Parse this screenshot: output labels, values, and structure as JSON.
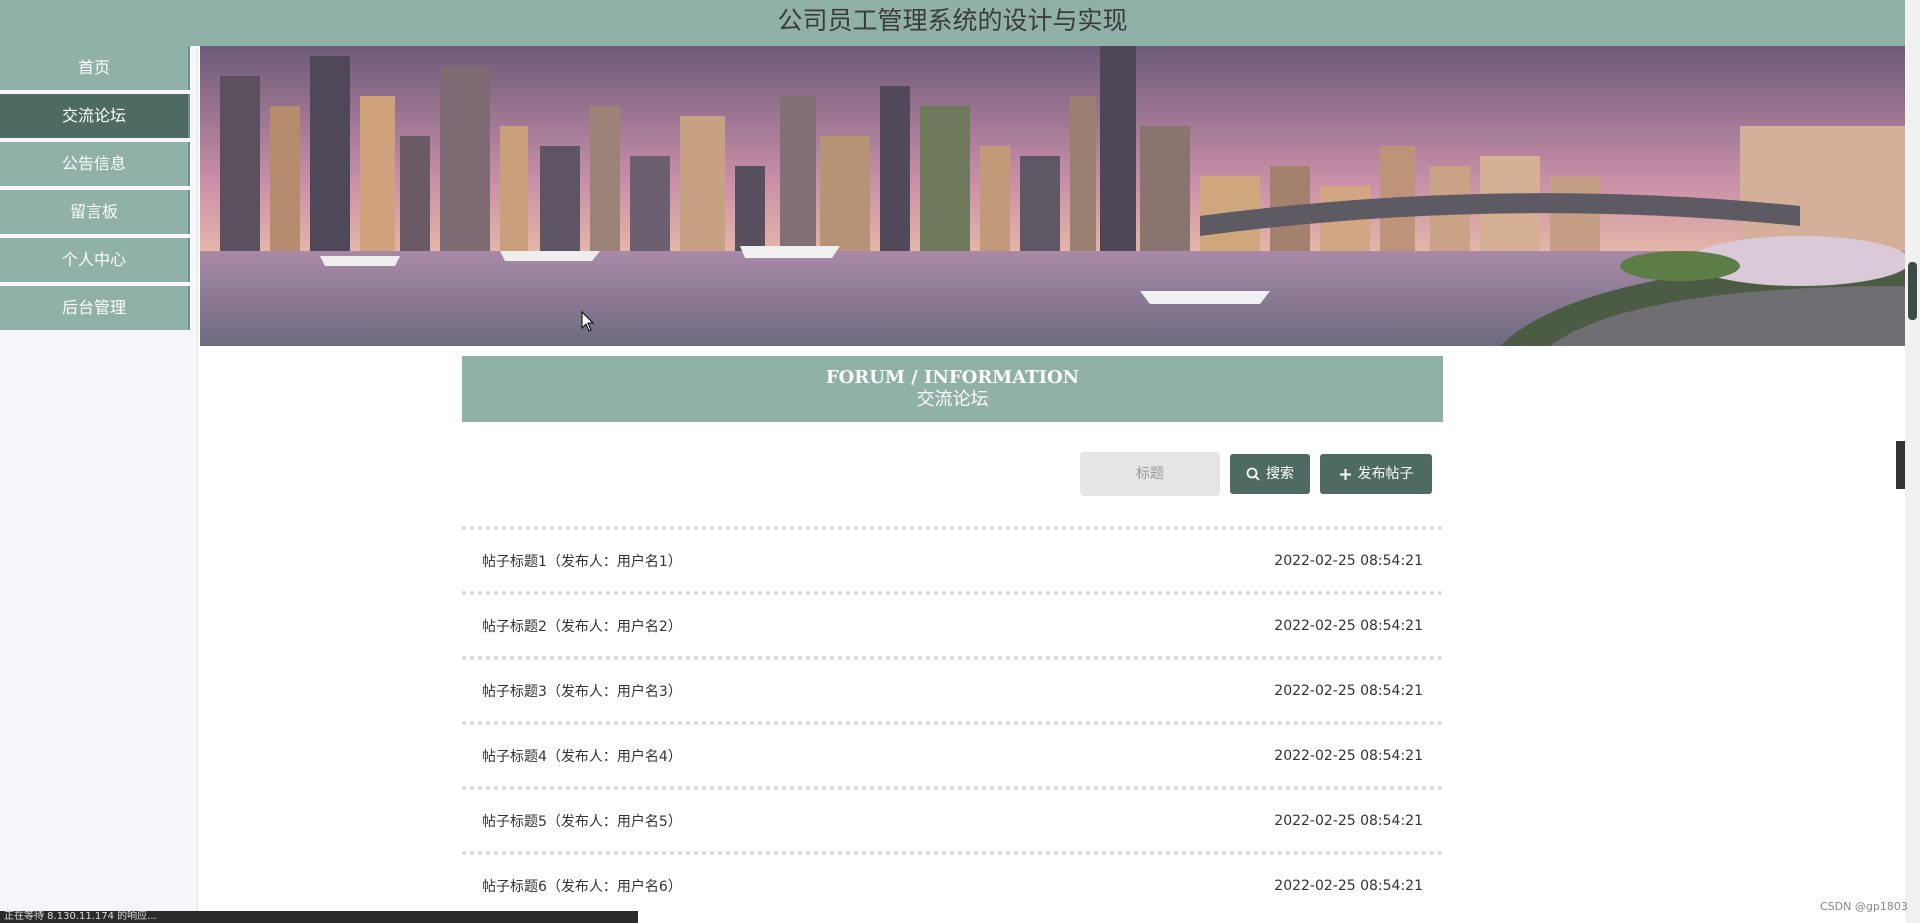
{
  "header": {
    "title": "公司员工管理系统的设计与实现"
  },
  "sidebar": {
    "items": [
      {
        "label": "首页",
        "active": false
      },
      {
        "label": "交流论坛",
        "active": true
      },
      {
        "label": "公告信息",
        "active": false
      },
      {
        "label": "留言板",
        "active": false
      },
      {
        "label": "个人中心",
        "active": false
      },
      {
        "label": "后台管理",
        "active": false
      }
    ]
  },
  "forum": {
    "title_en": "FORUM / INFORMATION",
    "title_cn": "交流论坛",
    "search_placeholder": "标题",
    "search_label": "搜索",
    "publish_label": "发布帖子",
    "posts": [
      {
        "title": "帖子标题1（发布人：用户名1）",
        "time": "2022-02-25 08:54:21"
      },
      {
        "title": "帖子标题2（发布人：用户名2）",
        "time": "2022-02-25 08:54:21"
      },
      {
        "title": "帖子标题3（发布人：用户名3）",
        "time": "2022-02-25 08:54:21"
      },
      {
        "title": "帖子标题4（发布人：用户名4）",
        "time": "2022-02-25 08:54:21"
      },
      {
        "title": "帖子标题5（发布人：用户名5）",
        "time": "2022-02-25 08:54:21"
      },
      {
        "title": "帖子标题6（发布人：用户名6）",
        "time": "2022-02-25 08:54:21"
      }
    ]
  },
  "status_bar": {
    "text": "正在等待 8.130.11.174 的响应..."
  },
  "watermark": "CSDN @gp1803",
  "colors": {
    "primary": "#8fb1a7",
    "dark": "#4e6b63"
  }
}
